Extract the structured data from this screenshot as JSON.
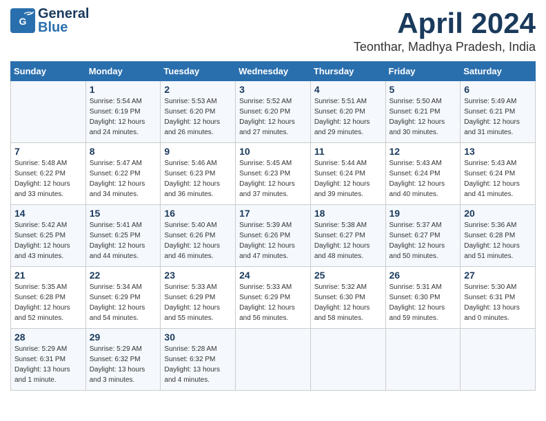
{
  "header": {
    "logo_line1": "General",
    "logo_line2": "Blue",
    "month": "April 2024",
    "location": "Teonthar, Madhya Pradesh, India"
  },
  "days_of_week": [
    "Sunday",
    "Monday",
    "Tuesday",
    "Wednesday",
    "Thursday",
    "Friday",
    "Saturday"
  ],
  "weeks": [
    [
      {
        "day": "",
        "info": ""
      },
      {
        "day": "1",
        "info": "Sunrise: 5:54 AM\nSunset: 6:19 PM\nDaylight: 12 hours\nand 24 minutes."
      },
      {
        "day": "2",
        "info": "Sunrise: 5:53 AM\nSunset: 6:20 PM\nDaylight: 12 hours\nand 26 minutes."
      },
      {
        "day": "3",
        "info": "Sunrise: 5:52 AM\nSunset: 6:20 PM\nDaylight: 12 hours\nand 27 minutes."
      },
      {
        "day": "4",
        "info": "Sunrise: 5:51 AM\nSunset: 6:20 PM\nDaylight: 12 hours\nand 29 minutes."
      },
      {
        "day": "5",
        "info": "Sunrise: 5:50 AM\nSunset: 6:21 PM\nDaylight: 12 hours\nand 30 minutes."
      },
      {
        "day": "6",
        "info": "Sunrise: 5:49 AM\nSunset: 6:21 PM\nDaylight: 12 hours\nand 31 minutes."
      }
    ],
    [
      {
        "day": "7",
        "info": "Sunrise: 5:48 AM\nSunset: 6:22 PM\nDaylight: 12 hours\nand 33 minutes."
      },
      {
        "day": "8",
        "info": "Sunrise: 5:47 AM\nSunset: 6:22 PM\nDaylight: 12 hours\nand 34 minutes."
      },
      {
        "day": "9",
        "info": "Sunrise: 5:46 AM\nSunset: 6:23 PM\nDaylight: 12 hours\nand 36 minutes."
      },
      {
        "day": "10",
        "info": "Sunrise: 5:45 AM\nSunset: 6:23 PM\nDaylight: 12 hours\nand 37 minutes."
      },
      {
        "day": "11",
        "info": "Sunrise: 5:44 AM\nSunset: 6:24 PM\nDaylight: 12 hours\nand 39 minutes."
      },
      {
        "day": "12",
        "info": "Sunrise: 5:43 AM\nSunset: 6:24 PM\nDaylight: 12 hours\nand 40 minutes."
      },
      {
        "day": "13",
        "info": "Sunrise: 5:43 AM\nSunset: 6:24 PM\nDaylight: 12 hours\nand 41 minutes."
      }
    ],
    [
      {
        "day": "14",
        "info": "Sunrise: 5:42 AM\nSunset: 6:25 PM\nDaylight: 12 hours\nand 43 minutes."
      },
      {
        "day": "15",
        "info": "Sunrise: 5:41 AM\nSunset: 6:25 PM\nDaylight: 12 hours\nand 44 minutes."
      },
      {
        "day": "16",
        "info": "Sunrise: 5:40 AM\nSunset: 6:26 PM\nDaylight: 12 hours\nand 46 minutes."
      },
      {
        "day": "17",
        "info": "Sunrise: 5:39 AM\nSunset: 6:26 PM\nDaylight: 12 hours\nand 47 minutes."
      },
      {
        "day": "18",
        "info": "Sunrise: 5:38 AM\nSunset: 6:27 PM\nDaylight: 12 hours\nand 48 minutes."
      },
      {
        "day": "19",
        "info": "Sunrise: 5:37 AM\nSunset: 6:27 PM\nDaylight: 12 hours\nand 50 minutes."
      },
      {
        "day": "20",
        "info": "Sunrise: 5:36 AM\nSunset: 6:28 PM\nDaylight: 12 hours\nand 51 minutes."
      }
    ],
    [
      {
        "day": "21",
        "info": "Sunrise: 5:35 AM\nSunset: 6:28 PM\nDaylight: 12 hours\nand 52 minutes."
      },
      {
        "day": "22",
        "info": "Sunrise: 5:34 AM\nSunset: 6:29 PM\nDaylight: 12 hours\nand 54 minutes."
      },
      {
        "day": "23",
        "info": "Sunrise: 5:33 AM\nSunset: 6:29 PM\nDaylight: 12 hours\nand 55 minutes."
      },
      {
        "day": "24",
        "info": "Sunrise: 5:33 AM\nSunset: 6:29 PM\nDaylight: 12 hours\nand 56 minutes."
      },
      {
        "day": "25",
        "info": "Sunrise: 5:32 AM\nSunset: 6:30 PM\nDaylight: 12 hours\nand 58 minutes."
      },
      {
        "day": "26",
        "info": "Sunrise: 5:31 AM\nSunset: 6:30 PM\nDaylight: 12 hours\nand 59 minutes."
      },
      {
        "day": "27",
        "info": "Sunrise: 5:30 AM\nSunset: 6:31 PM\nDaylight: 13 hours\nand 0 minutes."
      }
    ],
    [
      {
        "day": "28",
        "info": "Sunrise: 5:29 AM\nSunset: 6:31 PM\nDaylight: 13 hours\nand 1 minute."
      },
      {
        "day": "29",
        "info": "Sunrise: 5:29 AM\nSunset: 6:32 PM\nDaylight: 13 hours\nand 3 minutes."
      },
      {
        "day": "30",
        "info": "Sunrise: 5:28 AM\nSunset: 6:32 PM\nDaylight: 13 hours\nand 4 minutes."
      },
      {
        "day": "",
        "info": ""
      },
      {
        "day": "",
        "info": ""
      },
      {
        "day": "",
        "info": ""
      },
      {
        "day": "",
        "info": ""
      }
    ]
  ]
}
